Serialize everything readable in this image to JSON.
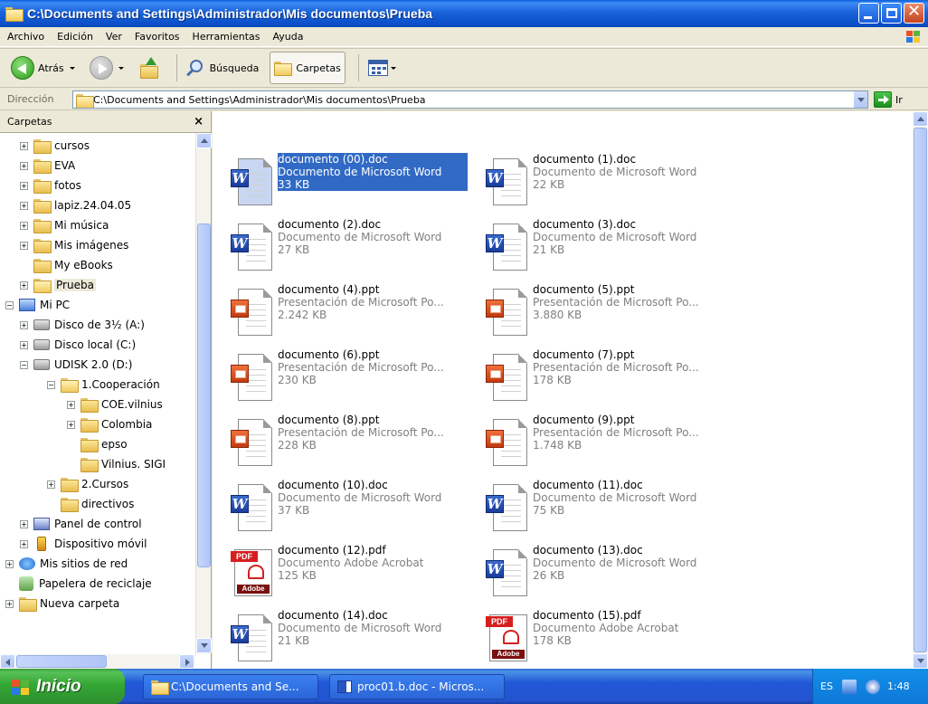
{
  "window": {
    "title": "C:\\Documents and Settings\\Administrador\\Mis documentos\\Prueba"
  },
  "menu": [
    "Archivo",
    "Edición",
    "Ver",
    "Favoritos",
    "Herramientas",
    "Ayuda"
  ],
  "toolbar": {
    "back_label": "Atrás",
    "search_label": "Búsqueda",
    "folders_label": "Carpetas"
  },
  "address": {
    "label": "Dirección",
    "value": "C:\\Documents and Settings\\Administrador\\Mis documentos\\Prueba",
    "go_label": "Ir"
  },
  "folders_pane": {
    "title": "Carpetas",
    "close_glyph": "×",
    "tree": [
      {
        "label": "cursos",
        "icon": "folder-icon",
        "expander": "+"
      },
      {
        "label": "EVA",
        "icon": "folder-icon",
        "expander": "+"
      },
      {
        "label": "fotos",
        "icon": "folder-icon",
        "expander": "+"
      },
      {
        "label": "lapiz.24.04.05",
        "icon": "folder-icon",
        "expander": "+"
      },
      {
        "label": "Mi música",
        "icon": "music-folder-icon",
        "expander": "+"
      },
      {
        "label": "Mis imágenes",
        "icon": "pictures-folder-icon",
        "expander": "+"
      },
      {
        "label": "My eBooks",
        "icon": "folder-icon",
        "expander": ""
      },
      {
        "label": "Prueba",
        "icon": "open-folder-icon",
        "expander": "+",
        "selected": true
      },
      {
        "label": "Mi PC",
        "icon": "computer-icon",
        "expander": "−"
      },
      {
        "label": "Disco de 3½ (A:)",
        "icon": "floppy-drive-icon",
        "expander": "+"
      },
      {
        "label": "Disco local (C:)",
        "icon": "hard-drive-icon",
        "expander": "+"
      },
      {
        "label": "UDISK 2.0 (D:)",
        "icon": "removable-drive-icon",
        "expander": "−"
      },
      {
        "label": "1.Cooperación",
        "icon": "open-folder-icon",
        "expander": "−"
      },
      {
        "label": "COE.vilnius",
        "icon": "folder-icon",
        "expander": "+"
      },
      {
        "label": "Colombia",
        "icon": "folder-icon",
        "expander": "+"
      },
      {
        "label": "epso",
        "icon": "folder-icon",
        "expander": ""
      },
      {
        "label": "Vilnius. SIGI",
        "icon": "folder-icon",
        "expander": ""
      },
      {
        "label": "2.Cursos",
        "icon": "folder-icon",
        "expander": "+"
      },
      {
        "label": "directivos",
        "icon": "folder-icon",
        "expander": ""
      },
      {
        "label": "Panel de control",
        "icon": "control-panel-icon",
        "expander": "+"
      },
      {
        "label": "Dispositivo móvil",
        "icon": "mobile-device-icon",
        "expander": "+"
      },
      {
        "label": "Mis sitios de red",
        "icon": "network-places-icon",
        "expander": "+"
      },
      {
        "label": "Papelera de reciclaje",
        "icon": "recycle-bin-icon",
        "expander": ""
      },
      {
        "label": "Nueva carpeta",
        "icon": "folder-icon",
        "expander": "+"
      }
    ]
  },
  "files": [
    {
      "name": "documento (00).doc",
      "type": "Documento de Microsoft Word",
      "size": "33 KB",
      "kind": "doc",
      "selected": true
    },
    {
      "name": "documento (1).doc",
      "type": "Documento de Microsoft Word",
      "size": "22 KB",
      "kind": "doc"
    },
    {
      "name": "documento (2).doc",
      "type": "Documento de Microsoft Word",
      "size": "27 KB",
      "kind": "doc"
    },
    {
      "name": "documento (3).doc",
      "type": "Documento de Microsoft Word",
      "size": "21 KB",
      "kind": "doc"
    },
    {
      "name": "documento (4).ppt",
      "type": "Presentación de Microsoft Po...",
      "size": "2.242 KB",
      "kind": "ppt"
    },
    {
      "name": "documento (5).ppt",
      "type": "Presentación de Microsoft Po...",
      "size": "3.880 KB",
      "kind": "ppt"
    },
    {
      "name": "documento (6).ppt",
      "type": "Presentación de Microsoft Po...",
      "size": "230 KB",
      "kind": "ppt"
    },
    {
      "name": "documento (7).ppt",
      "type": "Presentación de Microsoft Po...",
      "size": "178 KB",
      "kind": "ppt"
    },
    {
      "name": "documento (8).ppt",
      "type": "Presentación de Microsoft Po...",
      "size": "228 KB",
      "kind": "ppt"
    },
    {
      "name": "documento (9).ppt",
      "type": "Presentación de Microsoft Po...",
      "size": "1.748 KB",
      "kind": "ppt"
    },
    {
      "name": "documento (10).doc",
      "type": "Documento de Microsoft Word",
      "size": "37 KB",
      "kind": "doc"
    },
    {
      "name": "documento (11).doc",
      "type": "Documento de Microsoft Word",
      "size": "75 KB",
      "kind": "doc"
    },
    {
      "name": "documento (12).pdf",
      "type": "Documento Adobe Acrobat",
      "size": "125 KB",
      "kind": "pdf"
    },
    {
      "name": "documento (13).doc",
      "type": "Documento de Microsoft Word",
      "size": "26 KB",
      "kind": "doc"
    },
    {
      "name": "documento (14).doc",
      "type": "Documento de Microsoft Word",
      "size": "21 KB",
      "kind": "doc"
    },
    {
      "name": "documento (15).pdf",
      "type": "Documento Adobe Acrobat",
      "size": "178 KB",
      "kind": "pdf"
    }
  ],
  "icon_labels": {
    "word": "W",
    "pdf": "PDF",
    "adobe": "Adobe"
  },
  "taskbar": {
    "start_label": "Inicio",
    "tasks": [
      "C:\\Documents and Se...",
      "proc01.b.doc - Micros..."
    ],
    "language": "ES",
    "clock": "1:48"
  },
  "colors": {
    "selection": "#316AC5",
    "titlebar": "#0A5FD8",
    "start_green": "#33A733"
  }
}
